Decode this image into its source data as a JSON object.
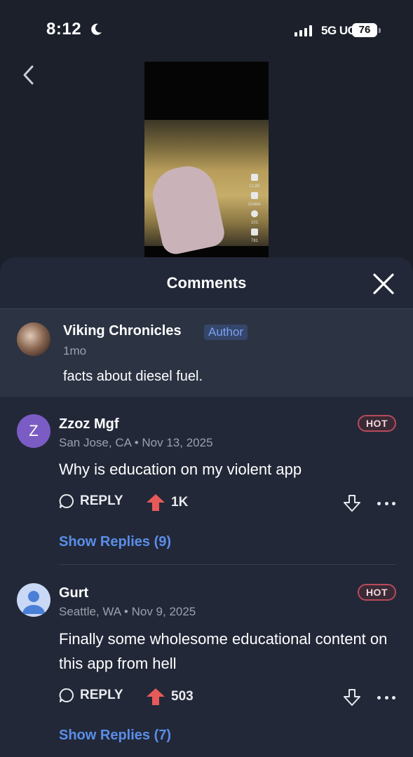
{
  "status_bar": {
    "time": "8:12",
    "network": "5G UC",
    "battery": "76"
  },
  "video": {
    "side_labels": [
      "12.8K",
      "Dislike",
      "101",
      "781"
    ]
  },
  "sheet": {
    "title": "Comments",
    "pinned": {
      "name": "Viking Chronicles",
      "badge": "Author",
      "age": "1mo",
      "text": "facts about diesel fuel."
    },
    "comments": [
      {
        "avatar_letter": "Z",
        "avatar_color": "#7b5cc4",
        "name": "Zzoz Mgf",
        "meta": "San Jose, CA • Nov 13, 2025",
        "badge": "HOT",
        "text": "Why is education on my violent app",
        "reply_label": "REPLY",
        "upvotes": "1K",
        "show_replies": "Show Replies (9)"
      },
      {
        "avatar_color": "#c9d8f5",
        "name": "Gurt",
        "meta": "Seattle, WA • Nov 9, 2025",
        "badge": "HOT",
        "text": "Finally some wholesome educational content on this app from hell",
        "reply_label": "REPLY",
        "upvotes": "503",
        "show_replies": "Show Replies (7)"
      }
    ]
  },
  "colors": {
    "accent_link": "#5a8ee8",
    "upvote": "#e85a5a",
    "hot_border": "#b94a5a"
  }
}
